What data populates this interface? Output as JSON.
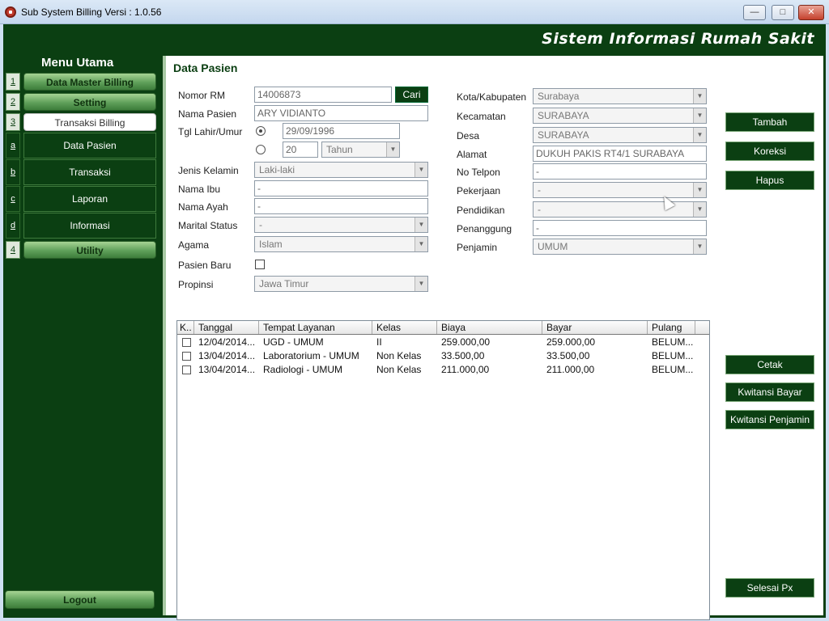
{
  "window": {
    "title": "Sub System Billing Versi : 1.0.56",
    "min_glyph": "—",
    "max_glyph": "□",
    "close_glyph": "✕"
  },
  "banner": {
    "title": "Sistem Informasi Rumah Sakit"
  },
  "sidebar": {
    "heading": "Menu Utama",
    "items": [
      {
        "num": "1",
        "label": "Data Master Billing"
      },
      {
        "num": "2",
        "label": "Setting"
      },
      {
        "num": "3",
        "label": "Transaksi Billing"
      },
      {
        "num": "4",
        "label": "Utility"
      }
    ],
    "subitems": [
      {
        "letter": "a",
        "label": "Data Pasien"
      },
      {
        "letter": "b",
        "label": "Transaksi"
      },
      {
        "letter": "c",
        "label": "Laporan"
      },
      {
        "letter": "d",
        "label": "Informasi"
      }
    ],
    "logout_label": "Logout"
  },
  "form": {
    "page_title": "Data Pasien",
    "nomor_rm": {
      "label": "Nomor RM",
      "value": "14006873"
    },
    "cari_label": "Cari",
    "nama_pasien": {
      "label": "Nama Pasien",
      "value": "ARY VIDIANTO"
    },
    "tgl_lahir": {
      "label": "Tgl Lahir/Umur",
      "date": "29/09/1996",
      "age": "20",
      "unit": "Tahun"
    },
    "jenis_kelamin": {
      "label": "Jenis Kelamin",
      "value": "Laki-laki"
    },
    "nama_ibu": {
      "label": "Nama Ibu",
      "value": "-"
    },
    "nama_ayah": {
      "label": "Nama Ayah",
      "value": "-"
    },
    "marital": {
      "label": "Marital Status",
      "value": "-"
    },
    "agama": {
      "label": "Agama",
      "value": "Islam"
    },
    "pasien_baru": {
      "label": "Pasien Baru"
    },
    "propinsi": {
      "label": "Propinsi",
      "value": "Jawa Timur"
    },
    "kota": {
      "label": "Kota/Kabupaten",
      "value": "Surabaya"
    },
    "kecamatan": {
      "label": "Kecamatan",
      "value": "SURABAYA"
    },
    "desa": {
      "label": "Desa",
      "value": "SURABAYA"
    },
    "alamat": {
      "label": "Alamat",
      "value": "DUKUH PAKIS RT4/1 SURABAYA"
    },
    "no_telpon": {
      "label": "No Telpon",
      "value": "-"
    },
    "pekerjaan": {
      "label": "Pekerjaan",
      "value": "-"
    },
    "pendidikan": {
      "label": "Pendidikan",
      "value": "-"
    },
    "penanggung": {
      "label": "Penanggung",
      "value": "-"
    },
    "penjamin": {
      "label": "Penjamin",
      "value": "UMUM"
    }
  },
  "actions": {
    "tambah": "Tambah",
    "koreksi": "Koreksi",
    "hapus": "Hapus",
    "cetak": "Cetak",
    "kwitansi_bayar": "Kwitansi Bayar",
    "kwitansi_penjamin": "Kwitansi Penjamin",
    "selesai": "Selesai Px"
  },
  "table": {
    "columns": [
      "K..",
      "Tanggal",
      "Tempat Layanan",
      "Kelas",
      "Biaya",
      "Bayar",
      "Pulang"
    ],
    "rows": [
      {
        "tanggal": "12/04/2014...",
        "tempat": "UGD - UMUM",
        "kelas": "II",
        "biaya": "259.000,00",
        "bayar": "259.000,00",
        "pulang": "BELUM..."
      },
      {
        "tanggal": "13/04/2014...",
        "tempat": "Laboratorium - UMUM",
        "kelas": "Non Kelas",
        "biaya": "33.500,00",
        "bayar": "33.500,00",
        "pulang": "BELUM..."
      },
      {
        "tanggal": "13/04/2014...",
        "tempat": "Radiologi - UMUM",
        "kelas": "Non Kelas",
        "biaya": "211.000,00",
        "bayar": "211.000,00",
        "pulang": "BELUM..."
      }
    ]
  }
}
